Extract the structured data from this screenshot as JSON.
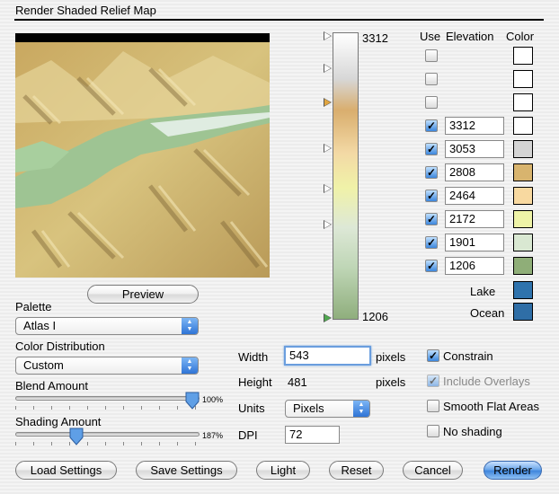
{
  "dialog": {
    "title": "Render Shaded Relief Map"
  },
  "preview": {
    "button_label": "Preview"
  },
  "palette": {
    "label": "Palette",
    "selected": "Atlas I"
  },
  "color_distribution": {
    "label": "Color Distribution",
    "selected": "Custom"
  },
  "blend": {
    "label": "Blend Amount",
    "value_text": "100%",
    "level": 1.0
  },
  "shading": {
    "label": "Shading Amount",
    "value_text": "187%",
    "level": 0.32
  },
  "ramp": {
    "max_label": "3312",
    "min_label": "1206"
  },
  "table": {
    "headers": {
      "use": "Use",
      "elevation": "Elevation",
      "color": "Color"
    },
    "rows": [
      {
        "use": false,
        "elevation": "",
        "color": "#ffffff"
      },
      {
        "use": false,
        "elevation": "",
        "color": "#ffffff"
      },
      {
        "use": false,
        "elevation": "",
        "color": "#ffffff"
      },
      {
        "use": true,
        "elevation": "3312",
        "color": "#ffffff"
      },
      {
        "use": true,
        "elevation": "3053",
        "color": "#d4d4d4"
      },
      {
        "use": true,
        "elevation": "2808",
        "color": "#d8b46e"
      },
      {
        "use": true,
        "elevation": "2464",
        "color": "#f8d9a0"
      },
      {
        "use": true,
        "elevation": "2172",
        "color": "#eef3a7"
      },
      {
        "use": true,
        "elevation": "1901",
        "color": "#d9e8d2"
      },
      {
        "use": true,
        "elevation": "1206",
        "color": "#8fae78"
      }
    ],
    "lake": {
      "label": "Lake",
      "color": "#2f73ad"
    },
    "ocean": {
      "label": "Ocean",
      "color": "#2f6ea6"
    }
  },
  "size": {
    "width_label": "Width",
    "width_value": "543",
    "width_unit": "pixels",
    "height_label": "Height",
    "height_value": "481",
    "height_unit": "pixels",
    "units_label": "Units",
    "units_selected": "Pixels",
    "dpi_label": "DPI",
    "dpi_value": "72"
  },
  "options": {
    "constrain": {
      "label": "Constrain",
      "checked": true
    },
    "include_overlays": {
      "label": "Include Overlays",
      "checked": true,
      "disabled": true
    },
    "smooth_flat": {
      "label": "Smooth Flat Areas",
      "checked": false
    },
    "no_shading": {
      "label": "No shading",
      "checked": false
    }
  },
  "buttons": {
    "load": "Load Settings",
    "save": "Save Settings",
    "light": "Light",
    "reset": "Reset",
    "cancel": "Cancel",
    "render": "Render"
  },
  "colors": {
    "accent": "#3f86dd",
    "lake": "#2f73ad"
  }
}
